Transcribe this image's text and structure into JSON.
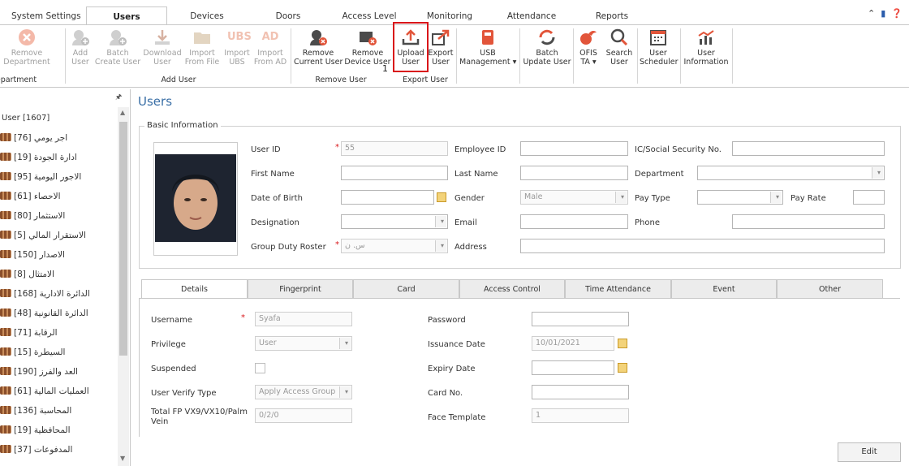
{
  "menu": {
    "tabs": [
      "System Settings",
      "Users",
      "Devices",
      "Doors",
      "Access Level",
      "Monitoring",
      "Attendance",
      "Reports"
    ],
    "active": "Users"
  },
  "ribbon": {
    "buttons": [
      {
        "label1": "Remove",
        "label2": "Department",
        "disabled": true,
        "icon": "remove-circle-icon"
      },
      {
        "label1": "Add",
        "label2": "User",
        "disabled": true,
        "icon": "add-user-icon"
      },
      {
        "label1": "Batch",
        "label2": "Create User",
        "disabled": true,
        "icon": "batch-create-icon"
      },
      {
        "label1": "Download",
        "label2": "User",
        "disabled": true,
        "icon": "download-icon"
      },
      {
        "label1": "Import",
        "label2": "From File",
        "disabled": true,
        "icon": "folder-icon"
      },
      {
        "label1": "Import",
        "label2": "UBS",
        "disabled": true,
        "icon": "ubs-icon"
      },
      {
        "label1": "Import",
        "label2": "From AD",
        "disabled": true,
        "icon": "ad-icon"
      },
      {
        "label1": "Remove",
        "label2": "Current User",
        "disabled": false,
        "icon": "remove-user-icon"
      },
      {
        "label1": "Remove",
        "label2": "Device User",
        "disabled": false,
        "icon": "remove-device-user-icon"
      },
      {
        "label1": "Upload",
        "label2": "User",
        "disabled": false,
        "icon": "upload-icon"
      },
      {
        "label1": "Export",
        "label2": "User",
        "disabled": false,
        "icon": "export-icon"
      },
      {
        "label1": "USB",
        "label2": "Management ▾",
        "disabled": false,
        "icon": "usb-icon"
      },
      {
        "label1": "Batch",
        "label2": "Update User",
        "disabled": false,
        "icon": "batch-update-icon"
      },
      {
        "label1": "OFIS",
        "label2": "TA ▾",
        "disabled": false,
        "icon": "ofis-icon"
      },
      {
        "label1": "Search",
        "label2": "User",
        "disabled": false,
        "icon": "search-icon"
      },
      {
        "label1": "User",
        "label2": "Scheduler",
        "disabled": false,
        "icon": "scheduler-icon"
      },
      {
        "label1": "User",
        "label2": "Information",
        "disabled": false,
        "icon": "chart-icon"
      }
    ],
    "groups": [
      "epartment",
      "Add User",
      "Remove User",
      "Export User"
    ],
    "badge": "1",
    "ubs_text": "UBS",
    "ad_text": "AD"
  },
  "tree": {
    "root": "User [1607]",
    "items": [
      "[76] اجر يومي",
      "[19] ادارة الجودة",
      "[95] الاجور اليومية",
      "[61] الاحصاء",
      "[80] الاستثمار",
      "[5] الاستقرار المالي",
      "[150] الاصدار",
      "[8] الامتثال",
      "[168] الدائرة الادارية",
      "[48] الدائرة القانونية",
      "[71] الرقابة",
      "[15] السيطرة",
      "[190] العد والفرز",
      "[61] العمليات المالية",
      "[136] المحاسبة",
      "[19] المحافظية",
      "[37] المدفوعات"
    ]
  },
  "main": {
    "title": "Users",
    "section": "Basic Information",
    "fields": {
      "user_id_label": "User ID",
      "user_id_value": "55",
      "first_name_label": "First Name",
      "dob_label": "Date of Birth",
      "designation_label": "Designation",
      "roster_label": "Group Duty Roster",
      "roster_value": "س. ن",
      "employee_id_label": "Employee ID",
      "last_name_label": "Last Name",
      "gender_label": "Gender",
      "gender_value": "Male",
      "email_label": "Email",
      "address_label": "Address",
      "ic_label": "IC/Social Security No.",
      "department_label": "Department",
      "pay_type_label": "Pay Type",
      "pay_rate_label": "Pay Rate",
      "phone_label": "Phone"
    },
    "tabs": [
      "Details",
      "Fingerprint",
      "Card",
      "Access Control",
      "Time Attendance",
      "Event",
      "Other"
    ],
    "details": {
      "username_label": "Username",
      "username_value": "Syafa",
      "privilege_label": "Privilege",
      "privilege_value": "User",
      "suspended_label": "Suspended",
      "verify_label": "User Verify Type",
      "verify_value": "Apply Access Group",
      "fp_label1": "Total FP VX9/VX10/Palm",
      "fp_label2": "Vein",
      "fp_value": "0/2/0",
      "password_label": "Password",
      "issuance_label": "Issuance Date",
      "issuance_value": "10/01/2021",
      "expiry_label": "Expiry Date",
      "card_label": "Card No.",
      "face_label": "Face Template",
      "face_value": "1"
    },
    "edit_label": "Edit"
  }
}
